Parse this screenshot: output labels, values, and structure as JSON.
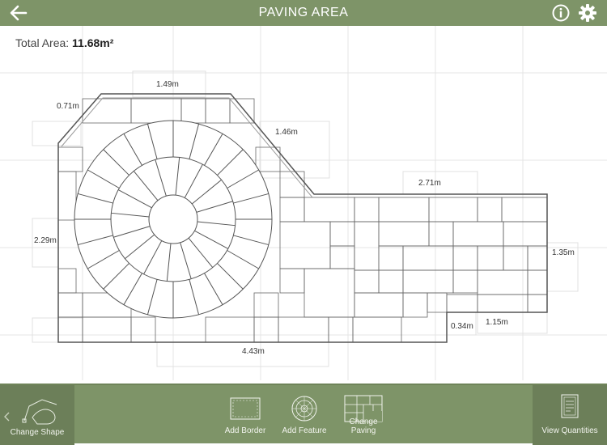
{
  "header": {
    "title": "PAVING AREA",
    "back_icon": "arrow-left-icon",
    "info_icon": "info-icon",
    "settings_icon": "gear-icon"
  },
  "total_area": {
    "label": "Total Area:",
    "value": "11.68m²"
  },
  "dimensions": {
    "top_edge": "1.49m",
    "left_chamfer": "0.71m",
    "diagonal": "1.46m",
    "right_top": "2.71m",
    "left_side": "2.29m",
    "right_side": "1.35m",
    "bottom": "4.43m",
    "notch_height": "0.34m",
    "notch_width": "1.15m"
  },
  "toolbar": {
    "change_shape": "Change Shape",
    "add_border": "Add Border",
    "add_feature": "Add Feature",
    "change_paving": "Change Paving",
    "view_quantities": "View Quantities"
  },
  "colors": {
    "bar": "#7e9468",
    "bar_dark": "#6c7f59"
  }
}
